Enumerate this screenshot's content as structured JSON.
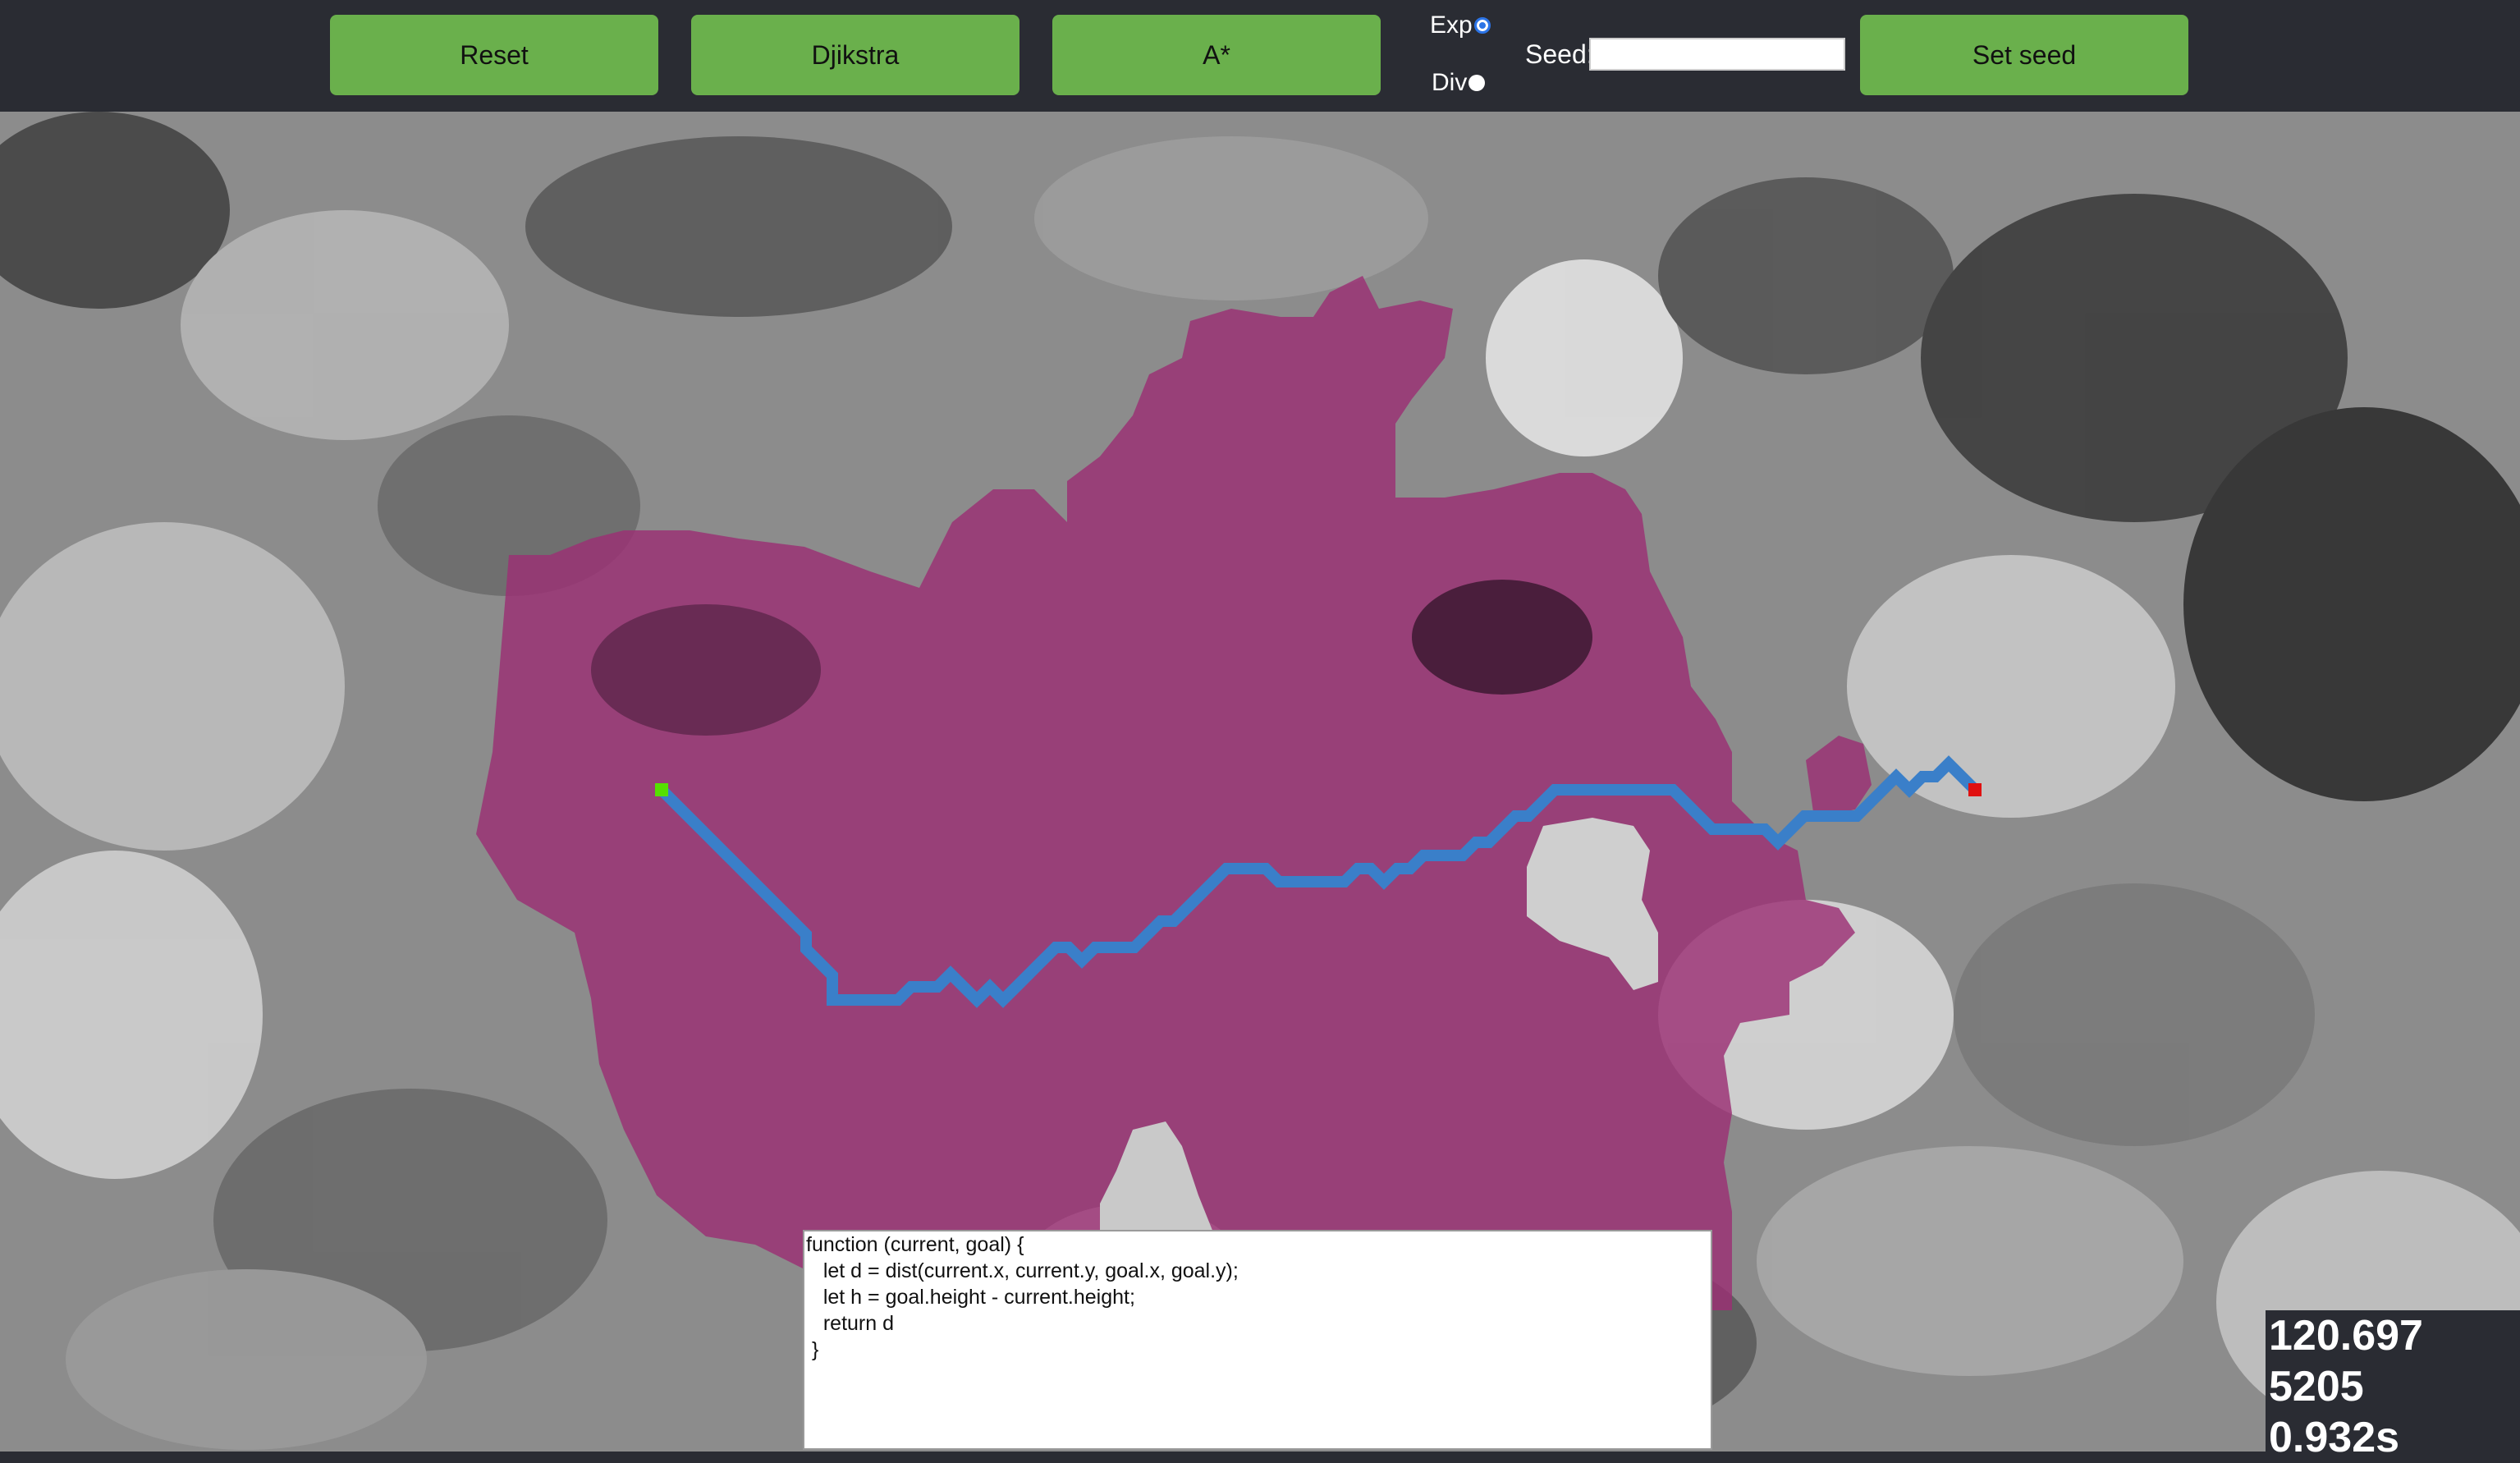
{
  "toolbar": {
    "reset_label": "Reset",
    "dijkstra_label": "Djikstra",
    "astar_label": "A*",
    "set_seed_label": "Set seed",
    "seed_label": "Seed:",
    "seed_value": "",
    "mode_options": [
      {
        "label": "Exp",
        "selected": true
      },
      {
        "label": "Div",
        "selected": false
      }
    ]
  },
  "editor": {
    "heuristic_code": "function (current, goal) {\n   let d = dist(current.x, current.y, goal.x, goal.y);\n   let h = goal.height - current.height;\n   return d\n }"
  },
  "stats": {
    "cost": "120.697",
    "nodes_explored": "5205",
    "time": "0.932s"
  },
  "colors": {
    "toolbar_bg": "#2a2c33",
    "button_green": "#6ab04c",
    "explored_region": "#9b2f74",
    "path_blue": "#3a7fc9",
    "start_node": "#55e000",
    "goal_node": "#e01010"
  }
}
